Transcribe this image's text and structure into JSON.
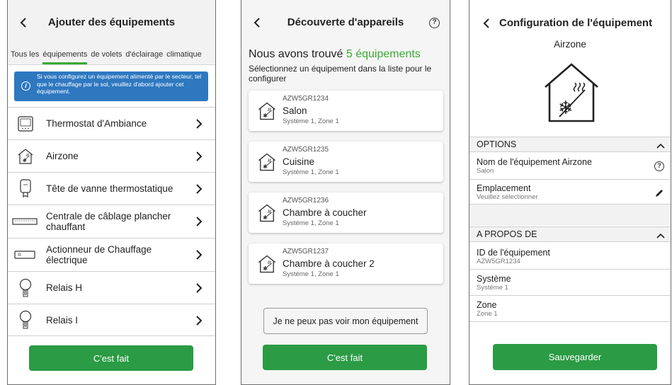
{
  "panel1": {
    "title": "Ajouter des équipements",
    "tabs": [
      "Tous les",
      "équipements",
      "de volets",
      "d'éclairage",
      "climatique"
    ],
    "info_text": "Si vous configurez un équipement alimenté par le secteur, tel que le chauffage par le sol, veuillez d'abord ajouter cet équipement.",
    "items": [
      {
        "label": "Thermostat d'Ambiance",
        "icon": "thermostat-icon"
      },
      {
        "label": "Airzone",
        "icon": "airzone-house-icon"
      },
      {
        "label": "Tête de vanne thermostatique",
        "icon": "valve-head-icon"
      },
      {
        "label": "Centrale de câblage plancher chauffant",
        "icon": "wiring-center-icon"
      },
      {
        "label": "Actionneur de Chauffage électrique",
        "icon": "heating-actuator-icon"
      },
      {
        "label": "Relais H",
        "icon": "relay-icon"
      },
      {
        "label": "Relais I",
        "icon": "relay-icon"
      }
    ],
    "done_label": "C'est fait"
  },
  "panel2": {
    "title": "Découverte d'appareils",
    "found_prefix": "Nous avons trouvé",
    "found_count": "5 équipements",
    "subtitle": "Sélectionnez un équipement dans la liste pour le configurer",
    "devices": [
      {
        "code": "AZW5GR1234",
        "name": "Salon",
        "meta": "Système 1, Zone 1"
      },
      {
        "code": "AZW5GR1235",
        "name": "Cuisine",
        "meta": "Système 1, Zone 1"
      },
      {
        "code": "AZW5GR1236",
        "name": "Chambre à coucher",
        "meta": "Système 1, Zone 1"
      },
      {
        "code": "AZW5GR1237",
        "name": "Chambre à coucher 2",
        "meta": "Système 1, Zone 1"
      }
    ],
    "cant_see_label": "Je ne peux pas voir mon équipement",
    "done_label": "C'est fait"
  },
  "panel3": {
    "title": "Configuration de l'équipement",
    "device_name": "Airzone",
    "options_header": "OPTIONS",
    "options": [
      {
        "key": "Nom de l'équipement Airzone",
        "value": "Salon"
      },
      {
        "key": "Emplacement",
        "value": "Veuillez sélectionner"
      }
    ],
    "about_header": "A PROPOS DE",
    "about": [
      {
        "key": "ID de l'équipement",
        "value": "AZW5GR1234"
      },
      {
        "key": "Système",
        "value": "Système 1"
      },
      {
        "key": "Zone",
        "value": "Zone 1"
      }
    ],
    "save_label": "Sauvegarder"
  },
  "colors": {
    "green": "#2b9b45",
    "accent_green": "#3aaa35",
    "info_blue": "#2e78c0"
  }
}
